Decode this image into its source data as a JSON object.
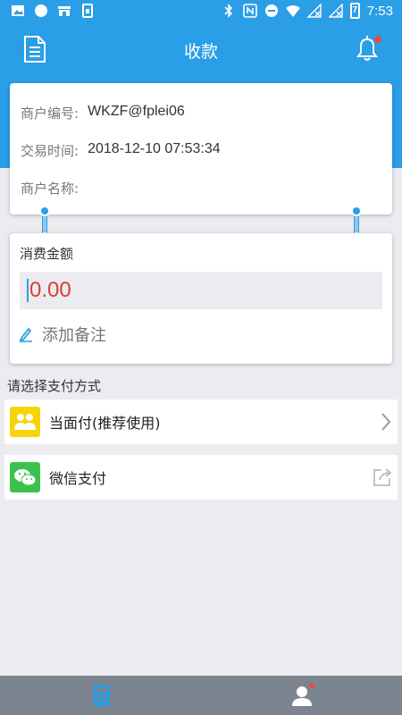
{
  "status_bar": {
    "time": "7:53",
    "battery": "7",
    "icons": [
      "image-icon",
      "circle-app-icon",
      "shop-icon",
      "sim-icon",
      "bluetooth-icon",
      "nfc-icon",
      "dnd-icon",
      "wifi-icon",
      "signal-off-icon",
      "signal-icon",
      "battery-icon"
    ]
  },
  "header": {
    "title": "收款",
    "left_icon": "document-list-icon",
    "right_icon": "bell-icon",
    "badge_color": "#e84a3d"
  },
  "merchant": {
    "id_label": "商户编号:",
    "id_value": "WKZF@fplei06",
    "time_label": "交易时间:",
    "time_value": "2018-12-10 07:53:34",
    "name_label": "商户名称:",
    "name_value": ""
  },
  "amount": {
    "label": "消费金额",
    "value": "0.00",
    "note_label": "添加备注"
  },
  "payment": {
    "section_title": "请选择支付方式",
    "methods": [
      {
        "label": "当面付(推荐使用)",
        "icon": "people-icon",
        "color": "#f5d50a",
        "action_icon": "chevron-right-icon"
      },
      {
        "label": "微信支付",
        "icon": "wechat-icon",
        "color": "#3cc24c",
        "action_icon": "share-icon"
      }
    ]
  },
  "bottom_nav": {
    "items": [
      {
        "icon": "calculator-icon",
        "active": true
      },
      {
        "icon": "user-icon",
        "active": false,
        "badge": true
      }
    ]
  },
  "colors": {
    "primary": "#2a9ee6",
    "amount_text": "#d9412b",
    "background": "#ebebf0"
  }
}
